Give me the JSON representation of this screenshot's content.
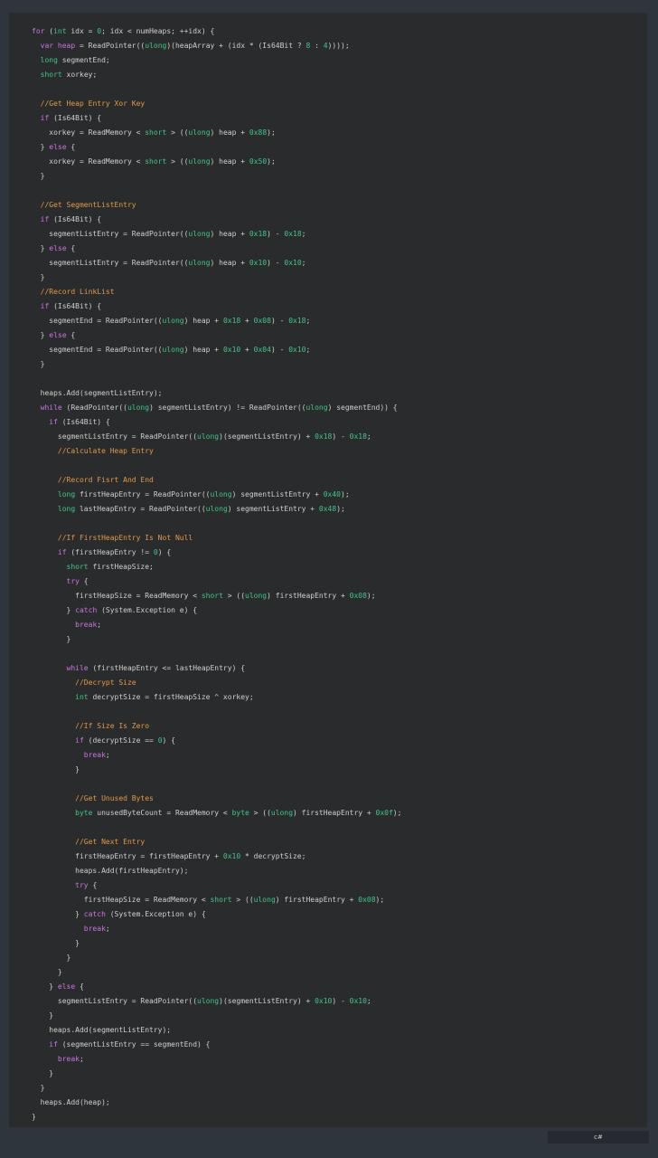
{
  "code": {
    "language_label": "c#",
    "lines": [
      [
        {
          "t": "kw",
          "s": "for"
        },
        {
          "t": "op",
          "s": " ("
        },
        {
          "t": "ty",
          "s": "int"
        },
        {
          "t": "op",
          "s": " idx = "
        },
        {
          "t": "num",
          "s": "0"
        },
        {
          "t": "op",
          "s": "; idx < numHeaps; ++idx) {"
        }
      ],
      [
        {
          "t": "op",
          "s": "  "
        },
        {
          "t": "kw",
          "s": "var"
        },
        {
          "t": "op",
          "s": " "
        },
        {
          "t": "kw",
          "s": "heap"
        },
        {
          "t": "op",
          "s": " = ReadPointer(("
        },
        {
          "t": "ty",
          "s": "ulong"
        },
        {
          "t": "op",
          "s": ")(heapArray + (idx * (Is64Bit ? "
        },
        {
          "t": "num",
          "s": "8"
        },
        {
          "t": "op",
          "s": " : "
        },
        {
          "t": "num",
          "s": "4"
        },
        {
          "t": "op",
          "s": "))));"
        }
      ],
      [
        {
          "t": "op",
          "s": "  "
        },
        {
          "t": "ty",
          "s": "long"
        },
        {
          "t": "op",
          "s": " segmentEnd;"
        }
      ],
      [
        {
          "t": "op",
          "s": "  "
        },
        {
          "t": "ty",
          "s": "short"
        },
        {
          "t": "op",
          "s": " xorkey;"
        }
      ],
      [],
      [
        {
          "t": "op",
          "s": "  "
        },
        {
          "t": "cm",
          "s": "//Get Heap Entry Xor Key"
        }
      ],
      [
        {
          "t": "op",
          "s": "  "
        },
        {
          "t": "kw",
          "s": "if"
        },
        {
          "t": "op",
          "s": " (Is64Bit) {"
        }
      ],
      [
        {
          "t": "op",
          "s": "    xorkey = ReadMemory < "
        },
        {
          "t": "ty",
          "s": "short"
        },
        {
          "t": "op",
          "s": " > (("
        },
        {
          "t": "ty",
          "s": "ulong"
        },
        {
          "t": "op",
          "s": ") heap + "
        },
        {
          "t": "num",
          "s": "0x88"
        },
        {
          "t": "op",
          "s": ");"
        }
      ],
      [
        {
          "t": "op",
          "s": "  } "
        },
        {
          "t": "kw",
          "s": "else"
        },
        {
          "t": "op",
          "s": " {"
        }
      ],
      [
        {
          "t": "op",
          "s": "    xorkey = ReadMemory < "
        },
        {
          "t": "ty",
          "s": "short"
        },
        {
          "t": "op",
          "s": " > (("
        },
        {
          "t": "ty",
          "s": "ulong"
        },
        {
          "t": "op",
          "s": ") heap + "
        },
        {
          "t": "num",
          "s": "0x50"
        },
        {
          "t": "op",
          "s": ");"
        }
      ],
      [
        {
          "t": "op",
          "s": "  }"
        }
      ],
      [],
      [
        {
          "t": "op",
          "s": "  "
        },
        {
          "t": "cm",
          "s": "//Get SegmentListEntry"
        }
      ],
      [
        {
          "t": "op",
          "s": "  "
        },
        {
          "t": "kw",
          "s": "if"
        },
        {
          "t": "op",
          "s": " (Is64Bit) {"
        }
      ],
      [
        {
          "t": "op",
          "s": "    segmentListEntry = ReadPointer(("
        },
        {
          "t": "ty",
          "s": "ulong"
        },
        {
          "t": "op",
          "s": ") heap + "
        },
        {
          "t": "num",
          "s": "0x18"
        },
        {
          "t": "op",
          "s": ") - "
        },
        {
          "t": "num",
          "s": "0x18"
        },
        {
          "t": "op",
          "s": ";"
        }
      ],
      [
        {
          "t": "op",
          "s": "  } "
        },
        {
          "t": "kw",
          "s": "else"
        },
        {
          "t": "op",
          "s": " {"
        }
      ],
      [
        {
          "t": "op",
          "s": "    segmentListEntry = ReadPointer(("
        },
        {
          "t": "ty",
          "s": "ulong"
        },
        {
          "t": "op",
          "s": ") heap + "
        },
        {
          "t": "num",
          "s": "0x10"
        },
        {
          "t": "op",
          "s": ") - "
        },
        {
          "t": "num",
          "s": "0x10"
        },
        {
          "t": "op",
          "s": ";"
        }
      ],
      [
        {
          "t": "op",
          "s": "  }"
        }
      ],
      [
        {
          "t": "op",
          "s": "  "
        },
        {
          "t": "cm",
          "s": "//Record LinkList"
        }
      ],
      [
        {
          "t": "op",
          "s": "  "
        },
        {
          "t": "kw",
          "s": "if"
        },
        {
          "t": "op",
          "s": " (Is64Bit) {"
        }
      ],
      [
        {
          "t": "op",
          "s": "    segmentEnd = ReadPointer(("
        },
        {
          "t": "ty",
          "s": "ulong"
        },
        {
          "t": "op",
          "s": ") heap + "
        },
        {
          "t": "num",
          "s": "0x18"
        },
        {
          "t": "op",
          "s": " + "
        },
        {
          "t": "num",
          "s": "0x08"
        },
        {
          "t": "op",
          "s": ") - "
        },
        {
          "t": "num",
          "s": "0x18"
        },
        {
          "t": "op",
          "s": ";"
        }
      ],
      [
        {
          "t": "op",
          "s": "  } "
        },
        {
          "t": "kw",
          "s": "else"
        },
        {
          "t": "op",
          "s": " {"
        }
      ],
      [
        {
          "t": "op",
          "s": "    segmentEnd = ReadPointer(("
        },
        {
          "t": "ty",
          "s": "ulong"
        },
        {
          "t": "op",
          "s": ") heap + "
        },
        {
          "t": "num",
          "s": "0x10"
        },
        {
          "t": "op",
          "s": " + "
        },
        {
          "t": "num",
          "s": "0x04"
        },
        {
          "t": "op",
          "s": ") - "
        },
        {
          "t": "num",
          "s": "0x10"
        },
        {
          "t": "op",
          "s": ";"
        }
      ],
      [
        {
          "t": "op",
          "s": "  }"
        }
      ],
      [],
      [
        {
          "t": "op",
          "s": "  heaps.Add(segmentListEntry);"
        }
      ],
      [
        {
          "t": "op",
          "s": "  "
        },
        {
          "t": "kw",
          "s": "while"
        },
        {
          "t": "op",
          "s": " (ReadPointer(("
        },
        {
          "t": "ty",
          "s": "ulong"
        },
        {
          "t": "op",
          "s": ") segmentListEntry) != ReadPointer(("
        },
        {
          "t": "ty",
          "s": "ulong"
        },
        {
          "t": "op",
          "s": ") segmentEnd)) {"
        }
      ],
      [
        {
          "t": "op",
          "s": "    "
        },
        {
          "t": "kw",
          "s": "if"
        },
        {
          "t": "op",
          "s": " (Is64Bit) {"
        }
      ],
      [
        {
          "t": "op",
          "s": "      segmentListEntry = ReadPointer(("
        },
        {
          "t": "ty",
          "s": "ulong"
        },
        {
          "t": "op",
          "s": ")(segmentListEntry) + "
        },
        {
          "t": "num",
          "s": "0x18"
        },
        {
          "t": "op",
          "s": ") - "
        },
        {
          "t": "num",
          "s": "0x18"
        },
        {
          "t": "op",
          "s": ";"
        }
      ],
      [
        {
          "t": "op",
          "s": "      "
        },
        {
          "t": "cm",
          "s": "//Calculate Heap Entry"
        }
      ],
      [],
      [
        {
          "t": "op",
          "s": "      "
        },
        {
          "t": "cm",
          "s": "//Record Fisrt And End"
        }
      ],
      [
        {
          "t": "op",
          "s": "      "
        },
        {
          "t": "ty",
          "s": "long"
        },
        {
          "t": "op",
          "s": " firstHeapEntry = ReadPointer(("
        },
        {
          "t": "ty",
          "s": "ulong"
        },
        {
          "t": "op",
          "s": ") segmentListEntry + "
        },
        {
          "t": "num",
          "s": "0x40"
        },
        {
          "t": "op",
          "s": ");"
        }
      ],
      [
        {
          "t": "op",
          "s": "      "
        },
        {
          "t": "ty",
          "s": "long"
        },
        {
          "t": "op",
          "s": " lastHeapEntry = ReadPointer(("
        },
        {
          "t": "ty",
          "s": "ulong"
        },
        {
          "t": "op",
          "s": ") segmentListEntry + "
        },
        {
          "t": "num",
          "s": "0x48"
        },
        {
          "t": "op",
          "s": ");"
        }
      ],
      [],
      [
        {
          "t": "op",
          "s": "      "
        },
        {
          "t": "cm",
          "s": "//If FirstHeapEntry Is Not Null"
        }
      ],
      [
        {
          "t": "op",
          "s": "      "
        },
        {
          "t": "kw",
          "s": "if"
        },
        {
          "t": "op",
          "s": " (firstHeapEntry != "
        },
        {
          "t": "num",
          "s": "0"
        },
        {
          "t": "op",
          "s": ") {"
        }
      ],
      [
        {
          "t": "op",
          "s": "        "
        },
        {
          "t": "ty",
          "s": "short"
        },
        {
          "t": "op",
          "s": " firstHeapSize;"
        }
      ],
      [
        {
          "t": "op",
          "s": "        "
        },
        {
          "t": "kw",
          "s": "try"
        },
        {
          "t": "op",
          "s": " {"
        }
      ],
      [
        {
          "t": "op",
          "s": "          firstHeapSize = ReadMemory < "
        },
        {
          "t": "ty",
          "s": "short"
        },
        {
          "t": "op",
          "s": " > (("
        },
        {
          "t": "ty",
          "s": "ulong"
        },
        {
          "t": "op",
          "s": ") firstHeapEntry + "
        },
        {
          "t": "num",
          "s": "0x08"
        },
        {
          "t": "op",
          "s": ");"
        }
      ],
      [
        {
          "t": "op",
          "s": "        } "
        },
        {
          "t": "kw",
          "s": "catch"
        },
        {
          "t": "op",
          "s": " (System.Exception e) {"
        }
      ],
      [
        {
          "t": "op",
          "s": "          "
        },
        {
          "t": "kw",
          "s": "break"
        },
        {
          "t": "op",
          "s": ";"
        }
      ],
      [
        {
          "t": "op",
          "s": "        }"
        }
      ],
      [],
      [
        {
          "t": "op",
          "s": "        "
        },
        {
          "t": "kw",
          "s": "while"
        },
        {
          "t": "op",
          "s": " (firstHeapEntry <= lastHeapEntry) {"
        }
      ],
      [
        {
          "t": "op",
          "s": "          "
        },
        {
          "t": "cm",
          "s": "//Decrypt Size"
        }
      ],
      [
        {
          "t": "op",
          "s": "          "
        },
        {
          "t": "ty",
          "s": "int"
        },
        {
          "t": "op",
          "s": " decryptSize = firstHeapSize ^ xorkey;"
        }
      ],
      [],
      [
        {
          "t": "op",
          "s": "          "
        },
        {
          "t": "cm",
          "s": "//If Size Is Zero"
        }
      ],
      [
        {
          "t": "op",
          "s": "          "
        },
        {
          "t": "kw",
          "s": "if"
        },
        {
          "t": "op",
          "s": " (decryptSize == "
        },
        {
          "t": "num",
          "s": "0"
        },
        {
          "t": "op",
          "s": ") {"
        }
      ],
      [
        {
          "t": "op",
          "s": "            "
        },
        {
          "t": "kw",
          "s": "break"
        },
        {
          "t": "op",
          "s": ";"
        }
      ],
      [
        {
          "t": "op",
          "s": "          }"
        }
      ],
      [],
      [
        {
          "t": "op",
          "s": "          "
        },
        {
          "t": "cm",
          "s": "//Get Unused Bytes"
        }
      ],
      [
        {
          "t": "op",
          "s": "          "
        },
        {
          "t": "ty",
          "s": "byte"
        },
        {
          "t": "op",
          "s": " unusedByteCount = ReadMemory < "
        },
        {
          "t": "ty",
          "s": "byte"
        },
        {
          "t": "op",
          "s": " > (("
        },
        {
          "t": "ty",
          "s": "ulong"
        },
        {
          "t": "op",
          "s": ") firstHeapEntry + "
        },
        {
          "t": "num",
          "s": "0x0f"
        },
        {
          "t": "op",
          "s": ");"
        }
      ],
      [],
      [
        {
          "t": "op",
          "s": "          "
        },
        {
          "t": "cm",
          "s": "//Get Next Entry"
        }
      ],
      [
        {
          "t": "op",
          "s": "          firstHeapEntry = firstHeapEntry + "
        },
        {
          "t": "num",
          "s": "0x10"
        },
        {
          "t": "op",
          "s": " * decryptSize;"
        }
      ],
      [
        {
          "t": "op",
          "s": "          heaps.Add(firstHeapEntry);"
        }
      ],
      [
        {
          "t": "op",
          "s": "          "
        },
        {
          "t": "kw",
          "s": "try"
        },
        {
          "t": "op",
          "s": " {"
        }
      ],
      [
        {
          "t": "op",
          "s": "            firstHeapSize = ReadMemory < "
        },
        {
          "t": "ty",
          "s": "short"
        },
        {
          "t": "op",
          "s": " > (("
        },
        {
          "t": "ty",
          "s": "ulong"
        },
        {
          "t": "op",
          "s": ") firstHeapEntry + "
        },
        {
          "t": "num",
          "s": "0x08"
        },
        {
          "t": "op",
          "s": ");"
        }
      ],
      [
        {
          "t": "op",
          "s": "          } "
        },
        {
          "t": "kw",
          "s": "catch"
        },
        {
          "t": "op",
          "s": " (System.Exception e) {"
        }
      ],
      [
        {
          "t": "op",
          "s": "            "
        },
        {
          "t": "kw",
          "s": "break"
        },
        {
          "t": "op",
          "s": ";"
        }
      ],
      [
        {
          "t": "op",
          "s": "          }"
        }
      ],
      [
        {
          "t": "op",
          "s": "        }"
        }
      ],
      [
        {
          "t": "op",
          "s": "      }"
        }
      ],
      [
        {
          "t": "op",
          "s": "    } "
        },
        {
          "t": "kw",
          "s": "else"
        },
        {
          "t": "op",
          "s": " {"
        }
      ],
      [
        {
          "t": "op",
          "s": "      segmentListEntry = ReadPointer(("
        },
        {
          "t": "ty",
          "s": "ulong"
        },
        {
          "t": "op",
          "s": ")(segmentListEntry) + "
        },
        {
          "t": "num",
          "s": "0x10"
        },
        {
          "t": "op",
          "s": ") - "
        },
        {
          "t": "num",
          "s": "0x10"
        },
        {
          "t": "op",
          "s": ";"
        }
      ],
      [
        {
          "t": "op",
          "s": "    }"
        }
      ],
      [
        {
          "t": "op",
          "s": "    heaps.Add(segmentListEntry);"
        }
      ],
      [
        {
          "t": "op",
          "s": "    "
        },
        {
          "t": "kw",
          "s": "if"
        },
        {
          "t": "op",
          "s": " (segmentListEntry == segmentEnd) {"
        }
      ],
      [
        {
          "t": "op",
          "s": "      "
        },
        {
          "t": "kw",
          "s": "break"
        },
        {
          "t": "op",
          "s": ";"
        }
      ],
      [
        {
          "t": "op",
          "s": "    }"
        }
      ],
      [
        {
          "t": "op",
          "s": "  }"
        }
      ],
      [
        {
          "t": "op",
          "s": "  heaps.Add(heap);"
        }
      ],
      [
        {
          "t": "op",
          "s": "}"
        }
      ]
    ]
  }
}
